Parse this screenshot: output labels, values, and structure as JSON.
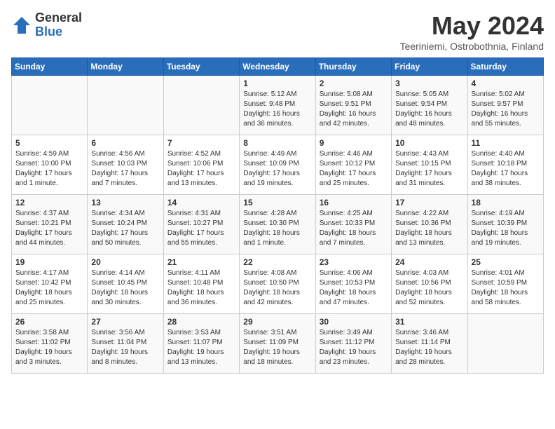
{
  "logo": {
    "general": "General",
    "blue": "Blue"
  },
  "header": {
    "month_year": "May 2024",
    "location": "Teeriniemi, Ostrobothnia, Finland"
  },
  "weekdays": [
    "Sunday",
    "Monday",
    "Tuesday",
    "Wednesday",
    "Thursday",
    "Friday",
    "Saturday"
  ],
  "weeks": [
    [
      {
        "day": "",
        "info": ""
      },
      {
        "day": "",
        "info": ""
      },
      {
        "day": "",
        "info": ""
      },
      {
        "day": "1",
        "info": "Sunrise: 5:12 AM\nSunset: 9:48 PM\nDaylight: 16 hours and 36 minutes."
      },
      {
        "day": "2",
        "info": "Sunrise: 5:08 AM\nSunset: 9:51 PM\nDaylight: 16 hours and 42 minutes."
      },
      {
        "day": "3",
        "info": "Sunrise: 5:05 AM\nSunset: 9:54 PM\nDaylight: 16 hours and 48 minutes."
      },
      {
        "day": "4",
        "info": "Sunrise: 5:02 AM\nSunset: 9:57 PM\nDaylight: 16 hours and 55 minutes."
      }
    ],
    [
      {
        "day": "5",
        "info": "Sunrise: 4:59 AM\nSunset: 10:00 PM\nDaylight: 17 hours and 1 minute."
      },
      {
        "day": "6",
        "info": "Sunrise: 4:56 AM\nSunset: 10:03 PM\nDaylight: 17 hours and 7 minutes."
      },
      {
        "day": "7",
        "info": "Sunrise: 4:52 AM\nSunset: 10:06 PM\nDaylight: 17 hours and 13 minutes."
      },
      {
        "day": "8",
        "info": "Sunrise: 4:49 AM\nSunset: 10:09 PM\nDaylight: 17 hours and 19 minutes."
      },
      {
        "day": "9",
        "info": "Sunrise: 4:46 AM\nSunset: 10:12 PM\nDaylight: 17 hours and 25 minutes."
      },
      {
        "day": "10",
        "info": "Sunrise: 4:43 AM\nSunset: 10:15 PM\nDaylight: 17 hours and 31 minutes."
      },
      {
        "day": "11",
        "info": "Sunrise: 4:40 AM\nSunset: 10:18 PM\nDaylight: 17 hours and 38 minutes."
      }
    ],
    [
      {
        "day": "12",
        "info": "Sunrise: 4:37 AM\nSunset: 10:21 PM\nDaylight: 17 hours and 44 minutes."
      },
      {
        "day": "13",
        "info": "Sunrise: 4:34 AM\nSunset: 10:24 PM\nDaylight: 17 hours and 50 minutes."
      },
      {
        "day": "14",
        "info": "Sunrise: 4:31 AM\nSunset: 10:27 PM\nDaylight: 17 hours and 55 minutes."
      },
      {
        "day": "15",
        "info": "Sunrise: 4:28 AM\nSunset: 10:30 PM\nDaylight: 18 hours and 1 minute."
      },
      {
        "day": "16",
        "info": "Sunrise: 4:25 AM\nSunset: 10:33 PM\nDaylight: 18 hours and 7 minutes."
      },
      {
        "day": "17",
        "info": "Sunrise: 4:22 AM\nSunset: 10:36 PM\nDaylight: 18 hours and 13 minutes."
      },
      {
        "day": "18",
        "info": "Sunrise: 4:19 AM\nSunset: 10:39 PM\nDaylight: 18 hours and 19 minutes."
      }
    ],
    [
      {
        "day": "19",
        "info": "Sunrise: 4:17 AM\nSunset: 10:42 PM\nDaylight: 18 hours and 25 minutes."
      },
      {
        "day": "20",
        "info": "Sunrise: 4:14 AM\nSunset: 10:45 PM\nDaylight: 18 hours and 30 minutes."
      },
      {
        "day": "21",
        "info": "Sunrise: 4:11 AM\nSunset: 10:48 PM\nDaylight: 18 hours and 36 minutes."
      },
      {
        "day": "22",
        "info": "Sunrise: 4:08 AM\nSunset: 10:50 PM\nDaylight: 18 hours and 42 minutes."
      },
      {
        "day": "23",
        "info": "Sunrise: 4:06 AM\nSunset: 10:53 PM\nDaylight: 18 hours and 47 minutes."
      },
      {
        "day": "24",
        "info": "Sunrise: 4:03 AM\nSunset: 10:56 PM\nDaylight: 18 hours and 52 minutes."
      },
      {
        "day": "25",
        "info": "Sunrise: 4:01 AM\nSunset: 10:59 PM\nDaylight: 18 hours and 58 minutes."
      }
    ],
    [
      {
        "day": "26",
        "info": "Sunrise: 3:58 AM\nSunset: 11:02 PM\nDaylight: 19 hours and 3 minutes."
      },
      {
        "day": "27",
        "info": "Sunrise: 3:56 AM\nSunset: 11:04 PM\nDaylight: 19 hours and 8 minutes."
      },
      {
        "day": "28",
        "info": "Sunrise: 3:53 AM\nSunset: 11:07 PM\nDaylight: 19 hours and 13 minutes."
      },
      {
        "day": "29",
        "info": "Sunrise: 3:51 AM\nSunset: 11:09 PM\nDaylight: 19 hours and 18 minutes."
      },
      {
        "day": "30",
        "info": "Sunrise: 3:49 AM\nSunset: 11:12 PM\nDaylight: 19 hours and 23 minutes."
      },
      {
        "day": "31",
        "info": "Sunrise: 3:46 AM\nSunset: 11:14 PM\nDaylight: 19 hours and 28 minutes."
      },
      {
        "day": "",
        "info": ""
      }
    ]
  ]
}
